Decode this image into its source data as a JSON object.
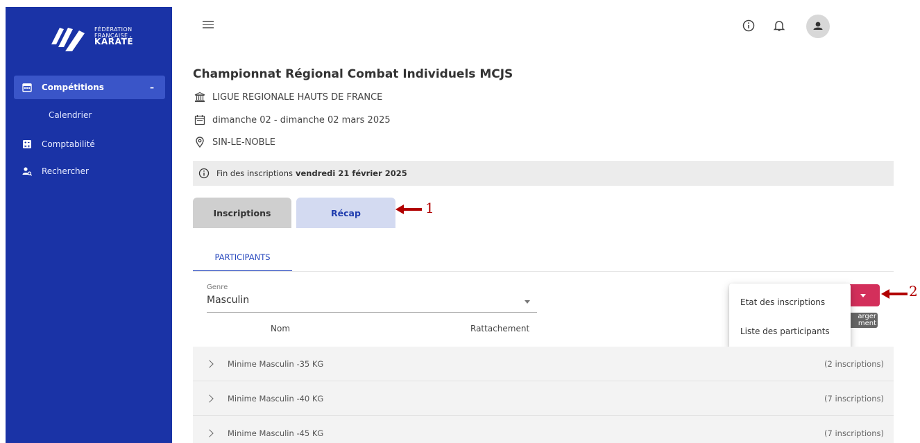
{
  "sidebar": {
    "logo": {
      "line1": "FÉDÉRATION",
      "line2": "FRANÇAISE",
      "line3": "KARATÉ"
    },
    "items": [
      {
        "label": "Compétitions",
        "icon": "calendar-icon",
        "expanded_marker": "–"
      },
      {
        "label": "Calendrier"
      },
      {
        "label": "Comptabilité",
        "icon": "calculator-icon"
      },
      {
        "label": "Rechercher",
        "icon": "user-search-icon"
      }
    ]
  },
  "header": {
    "icons": [
      "menu-icon",
      "info-icon",
      "bell-icon",
      "avatar-icon"
    ]
  },
  "competition": {
    "title": "Championnat Régional Combat Individuels MCJS",
    "organizer": "LIGUE REGIONALE HAUTS DE FRANCE",
    "dates": "dimanche 02 - dimanche 02 mars 2025",
    "location": "SIN-LE-NOBLE"
  },
  "notice": {
    "text": "Fin des inscriptions",
    "date": "vendredi 21 février 2025"
  },
  "tabs": [
    {
      "label": "Inscriptions"
    },
    {
      "label": "Récap",
      "active": true
    }
  ],
  "subtabs": [
    {
      "label": "PARTICIPANTS",
      "active": true
    }
  ],
  "filter": {
    "genre_label": "Genre",
    "genre_value": "Masculin"
  },
  "columns": {
    "nom": "Nom",
    "rattachement": "Rattachement"
  },
  "download": {
    "tooltip_line1": "arger",
    "tooltip_line2": "ment",
    "menu": [
      "Etat des inscriptions",
      "Liste des participants"
    ]
  },
  "rows": [
    {
      "label": "Minime Masculin -35 KG",
      "count": "(2 inscriptions)"
    },
    {
      "label": "Minime Masculin -40 KG",
      "count": "(7 inscriptions)"
    },
    {
      "label": "Minime Masculin -45 KG",
      "count": "(7 inscriptions)"
    }
  ],
  "annotations": {
    "one": "1",
    "two": "2"
  },
  "colors": {
    "sidebar": "#1a33a6",
    "accent": "#d32f5b",
    "annotation": "#b10000"
  }
}
